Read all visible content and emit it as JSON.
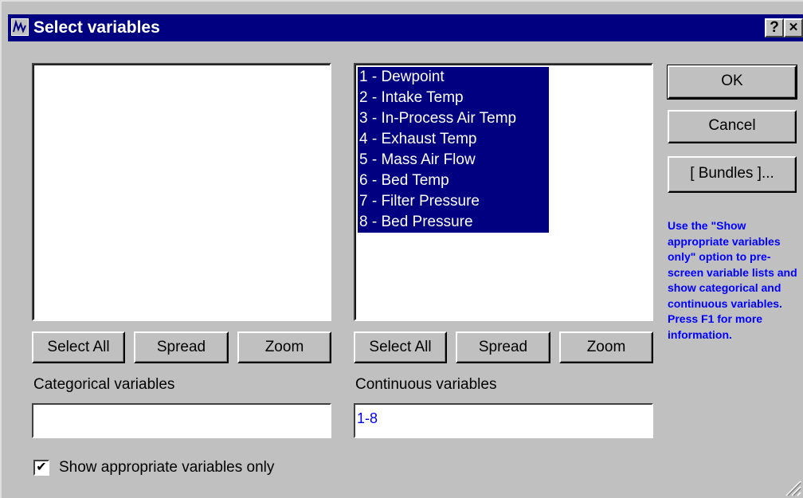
{
  "window": {
    "title": "Select variables",
    "help_button": "?",
    "close_button": "✕"
  },
  "left_list": {
    "items": [],
    "select_all": "Select All",
    "spread": "Spread",
    "zoom": "Zoom",
    "label": "Categorical variables",
    "field_value": ""
  },
  "right_list": {
    "items": [
      "1 - Dewpoint",
      "2 - Intake Temp",
      "3 - In-Process Air Temp",
      "4 - Exhaust Temp",
      "5 - Mass Air Flow",
      "6 - Bed Temp",
      "7 - Filter Pressure",
      "8 - Bed Pressure"
    ],
    "select_all": "Select All",
    "spread": "Spread",
    "zoom": "Zoom",
    "label": "Continuous variables",
    "field_value": "1-8"
  },
  "side_buttons": {
    "ok": "OK",
    "cancel": "Cancel",
    "bundles": "[ Bundles ]..."
  },
  "help_text": "Use the \"Show appropriate variables only\" option to pre-screen variable lists and show categorical and continuous variables. Press F1 for more information.",
  "checkbox": {
    "label": "Show appropriate variables only",
    "checked": true,
    "mark": "✔"
  },
  "colors": {
    "face": "#c0c0c0",
    "title_bar": "#000080",
    "selection": "#000080",
    "help_text": "#0000ff"
  }
}
